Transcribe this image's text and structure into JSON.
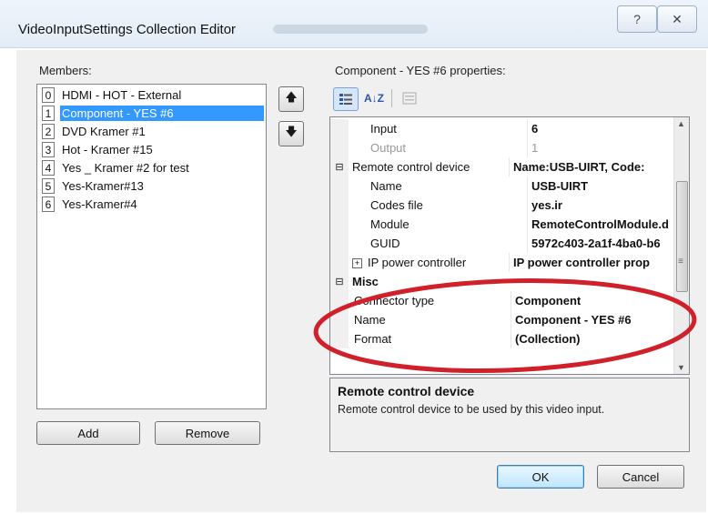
{
  "window": {
    "title": "VideoInputSettings Collection Editor",
    "help_glyph": "?",
    "close_glyph": "✕"
  },
  "members": {
    "label": "Members:",
    "items": [
      {
        "index": "0",
        "name": "HDMI - HOT - External",
        "selected": false
      },
      {
        "index": "1",
        "name": "Component - YES #6",
        "selected": true
      },
      {
        "index": "2",
        "name": "DVD Kramer #1",
        "selected": false
      },
      {
        "index": "3",
        "name": "Hot - Kramer #15",
        "selected": false
      },
      {
        "index": "4",
        "name": "Yes _ Kramer #2 for test",
        "selected": false
      },
      {
        "index": "5",
        "name": "Yes-Kramer#13",
        "selected": false
      },
      {
        "index": "6",
        "name": "Yes-Kramer#4",
        "selected": false
      }
    ],
    "move_up_glyph": "🡅",
    "move_down_glyph": "🡇",
    "add_label": "Add",
    "remove_label": "Remove"
  },
  "properties": {
    "label": "Component - YES #6 properties:",
    "toolbar": {
      "categorized_icon": "categorized-icon",
      "alphabetical_label": "A↓Z",
      "pages_icon": "property-pages-icon"
    },
    "rows": {
      "input": {
        "name": "Input",
        "value": "6"
      },
      "output": {
        "name": "Output",
        "value": "1"
      },
      "remote_control_device": {
        "name": "Remote control device",
        "value": "Name:USB-UIRT, Code:"
      },
      "rc_name": {
        "name": "Name",
        "value": "USB-UIRT"
      },
      "codes_file": {
        "name": "Codes file",
        "value": "yes.ir"
      },
      "module": {
        "name": "Module",
        "value": "RemoteControlModule.d"
      },
      "guid": {
        "name": "GUID",
        "value": "5972c403-2a1f-4ba0-b6"
      },
      "ip_power_controller": {
        "name": "IP power controller",
        "value": "IP power controller prop"
      },
      "misc": {
        "name": "Misc",
        "value": ""
      },
      "connector_type": {
        "name": "Connector type",
        "value": "Component"
      },
      "misc_name": {
        "name": "Name",
        "value": "Component - YES #6"
      },
      "format": {
        "name": "Format",
        "value": "(Collection)"
      }
    },
    "expand_glyph": "⊞",
    "collapse_glyph": "⊟"
  },
  "description": {
    "title": "Remote control device",
    "text": "Remote control device to be used by this video input."
  },
  "footer": {
    "ok_label": "OK",
    "cancel_label": "Cancel"
  },
  "colors": {
    "selection": "#3399ff",
    "annotation": "#d0202a"
  }
}
